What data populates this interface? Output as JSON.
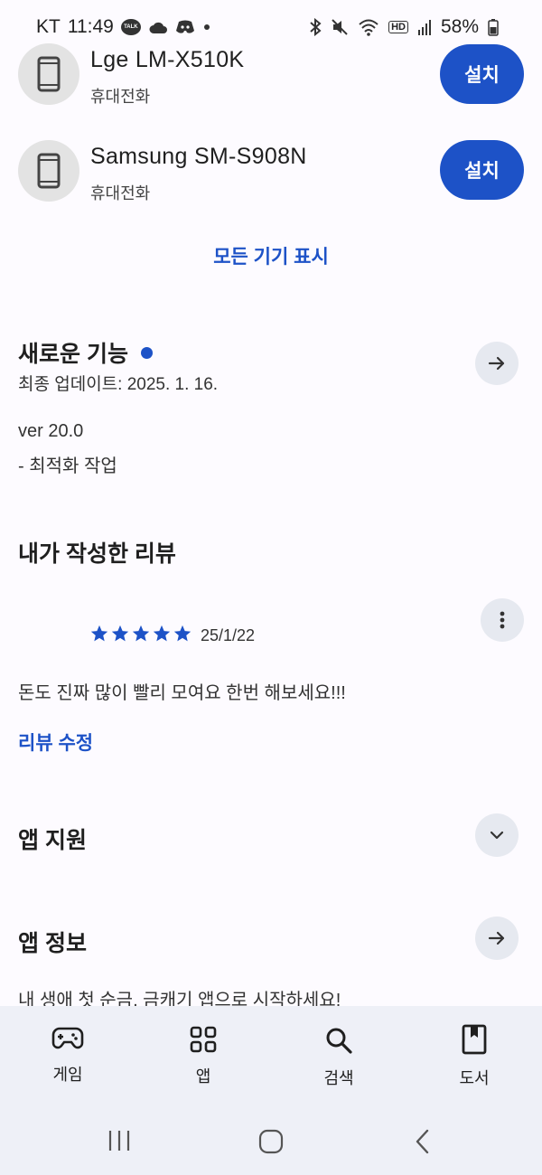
{
  "status": {
    "carrier": "KT",
    "time": "11:49",
    "talk": "TALK",
    "hd": "HD",
    "battery": "58%"
  },
  "devices": [
    {
      "name": "Lge LM-X510K",
      "type": "휴대전화",
      "button": "설치"
    },
    {
      "name": "Samsung SM-S908N",
      "type": "휴대전화",
      "button": "설치"
    }
  ],
  "show_all_devices": "모든 기기 표시",
  "whats_new": {
    "title": "새로운 기능",
    "updated": "최종 업데이트: 2025. 1. 16.",
    "version": "ver 20.0",
    "note": "- 최적화 작업"
  },
  "my_review": {
    "title": "내가 작성한 리뷰",
    "rating": 5,
    "date": "25/1/22",
    "text": "돈도 진짜 많이 빨리 모여요 한번 해보세요!!!",
    "edit": "리뷰 수정"
  },
  "app_support": {
    "title": "앱 지원"
  },
  "app_info": {
    "title": "앱 정보",
    "description": "내 생애 첫 순금, 금캐기 앱으로 시작하세요!"
  },
  "bottom_nav": [
    {
      "label": "게임",
      "icon": "gamepad-icon"
    },
    {
      "label": "앱",
      "icon": "apps-grid-icon"
    },
    {
      "label": "검색",
      "icon": "search-icon"
    },
    {
      "label": "도서",
      "icon": "book-icon"
    }
  ],
  "colors": {
    "accent": "#1d52c7",
    "nav_bg": "#eef0f7",
    "page_bg": "#fdfbff"
  }
}
